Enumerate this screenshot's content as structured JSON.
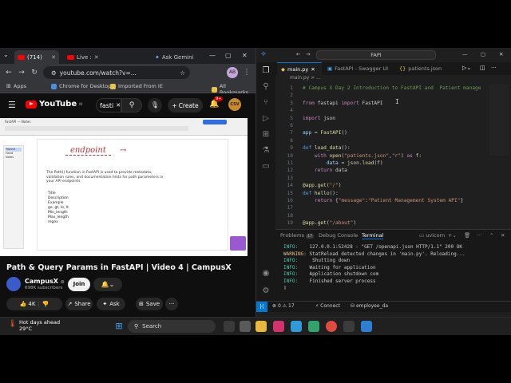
{
  "chrome": {
    "tabs": [
      {
        "label": "(714)"
      },
      {
        "label": "Live :"
      },
      {
        "label": "Ask Gemini"
      }
    ],
    "url": "youtube.com/watch?v=...",
    "bookmarks": [
      "Apps",
      "Chrome for Desktop",
      "Imported From IE",
      "All Bookmarks"
    ],
    "profile_initials": "AB"
  },
  "youtube": {
    "logo": "YouTube",
    "logo_sup": "IN",
    "search_query": "fasti",
    "create_label": "Create",
    "notifications": "9+",
    "avatar_text": "CSV"
  },
  "video": {
    "toolbar_text": "FastAPI — Notes",
    "handwriting": "endpoint",
    "arrow": "→",
    "description": "The Path() function in FastAPI is used to provide metadata, validation rules, and documentation hints for path parameters in your API endpoints.",
    "list": [
      "Title",
      "Description",
      "Example",
      "ge, gt, le, lt",
      "Min_length",
      "Max_length",
      "regex"
    ],
    "side_items": [
      "Patient",
      "Hand Notes"
    ]
  },
  "watch": {
    "title": "Path & Query Params in FastAPI | Video 4 | CampusX",
    "channel": "CampusX",
    "verified": "⊙",
    "subscribers": "698K subscribers",
    "join_label": "Join",
    "likes": "4K",
    "share_label": "Share",
    "ask_label": "Ask",
    "save_label": "Save",
    "more": "···"
  },
  "vscode": {
    "search_title": "FAPI",
    "tabs": [
      "main.py",
      "FastAPI - Swagger UI",
      "patients.json"
    ],
    "breadcrumb": "main.py > ...",
    "lines": [
      {
        "n": "1",
        "html": "<span class='cm'># Campus X Day 2 Introduction to FastAPI and  Patient manage</span>"
      },
      {
        "n": "2",
        "html": ""
      },
      {
        "n": "3",
        "html": "<span class='kw'>from</span> fastapi <span class='kw'>import</span> FastAPI"
      },
      {
        "n": "4",
        "html": ""
      },
      {
        "n": "5",
        "html": "<span class='kw'>import</span> json"
      },
      {
        "n": "6",
        "html": ""
      },
      {
        "n": "7",
        "html": "<span class='var'>app</span> = <span class='fn'>FastAPI</span>()"
      },
      {
        "n": "8",
        "html": ""
      },
      {
        "n": "9",
        "html": "<span class='kb'>def</span> <span class='fn'>load_data</span>():"
      },
      {
        "n": "10",
        "html": "    <span class='kw'>with</span> <span class='fn'>open</span>(<span class='st'>\"patients.json\"</span>,<span class='st'>\"r\"</span>) <span class='kw'>as</span> f:"
      },
      {
        "n": "11",
        "html": "        <span class='var'>data</span> = json.<span class='fn'>load</span>(f)"
      },
      {
        "n": "12",
        "html": "    <span class='kw'>return</span> data"
      },
      {
        "n": "13",
        "html": ""
      },
      {
        "n": "14",
        "html": "<span class='dec'>@app.get</span>(<span class='st'>\"/\"</span>)"
      },
      {
        "n": "15",
        "html": "<span class='kb'>def</span> <span class='fn'>hello</span>():"
      },
      {
        "n": "16",
        "html": "    <span class='kw'>return</span> {<span class='st'>\"message\"</span>:<span class='st'>\"Patient Management System API\"</span>}"
      },
      {
        "n": "17",
        "html": ""
      },
      {
        "n": "18",
        "html": ""
      },
      {
        "n": "19",
        "html": "<span class='dec'>@app.get</span>(<span class='st'>\"/about\"</span>)"
      }
    ],
    "panel_tabs": [
      "Problems",
      "17",
      "Debug Console",
      "Terminal"
    ],
    "terminal_name": "uvicorn",
    "terminal": [
      {
        "label": "INFO:",
        "text": "    127.0.0.1:52428 - \"GET /openapi.json HTTP/1.1\" 200 OK"
      },
      {
        "label": "WARNING:",
        "text": " StatReload detected changes in 'main.py'. Reloading..."
      },
      {
        "label": "INFO:",
        "text": "     Shutting down"
      },
      {
        "label": "INFO:",
        "text": "    Waiting for application"
      },
      {
        "label": "INFO:",
        "text": "    Application shutdown com"
      },
      {
        "label": "INFO:",
        "text": "    Finished server process"
      },
      {
        "label": "",
        "text": "▯"
      }
    ],
    "status": {
      "errors": "0",
      "warnings": "17",
      "connect": "Connect",
      "extra": "employee_da"
    }
  },
  "taskbar": {
    "weather_title": "Hot days ahead",
    "weather_temp": "29°C",
    "search_placeholder": "Search"
  },
  "colors": {
    "accent": "#0078d4",
    "yt_red": "#ff0000"
  }
}
